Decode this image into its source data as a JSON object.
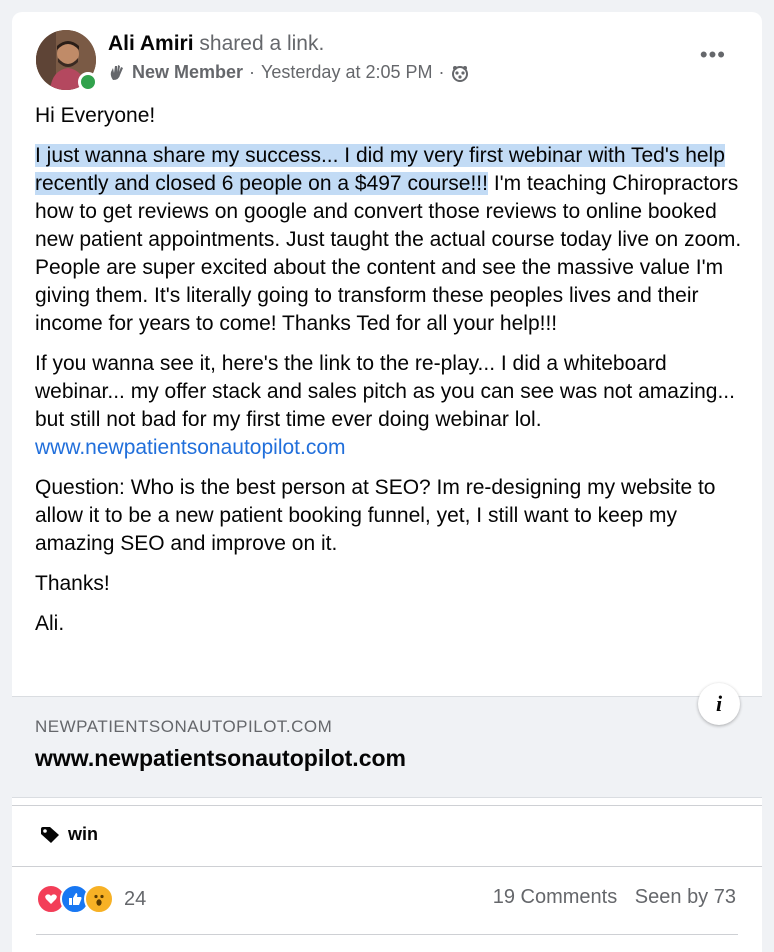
{
  "post": {
    "author": "Ali Amiri",
    "action": "shared a link.",
    "badge": "New Member",
    "timestamp": "Yesterday at 2:05 PM",
    "separator": "·"
  },
  "body": {
    "greeting": "Hi Everyone!",
    "highlight": "I just wanna share my success... I did my very first webinar with Ted's help recently and closed 6 people on a $497 course!!!",
    "para1_rest": " I'm teaching Chiropractors how to get reviews on google and convert those reviews to online booked new patient appointments. Just taught the actual course today live on zoom. People are super excited about the content and see the massive value I'm giving them. It's literally going to transform these peoples lives and their income for years to come! Thanks Ted for all your help!!!",
    "para2": "If you wanna see it, here's the link to the re-play... I did a whiteboard webinar... my offer stack and sales pitch as you can see was not amazing... but still not bad for my first time ever doing webinar lol. ",
    "link": "www.newpatientsonautopilot.com",
    "para3": "Question: Who is the best person at SEO? Im re-designing my website to allow it to be a new patient booking funnel, yet, I still want to keep my amazing SEO and improve on it.",
    "thanks": "Thanks!",
    "signoff": "Ali."
  },
  "preview": {
    "domain": "NEWPATIENTSONAUTOPILOT.COM",
    "title": "www.newpatientsonautopilot.com",
    "info_glyph": "i"
  },
  "topic": {
    "label": "win"
  },
  "footer": {
    "reaction_count": "24",
    "comments": "19 Comments",
    "seen": "Seen by 73"
  },
  "colors": {
    "link": "#216fdb",
    "highlight": "#c2dbf5",
    "online": "#31a24c",
    "like": "#1877f2",
    "love": "#f33e58",
    "wow": "#f7b125"
  }
}
